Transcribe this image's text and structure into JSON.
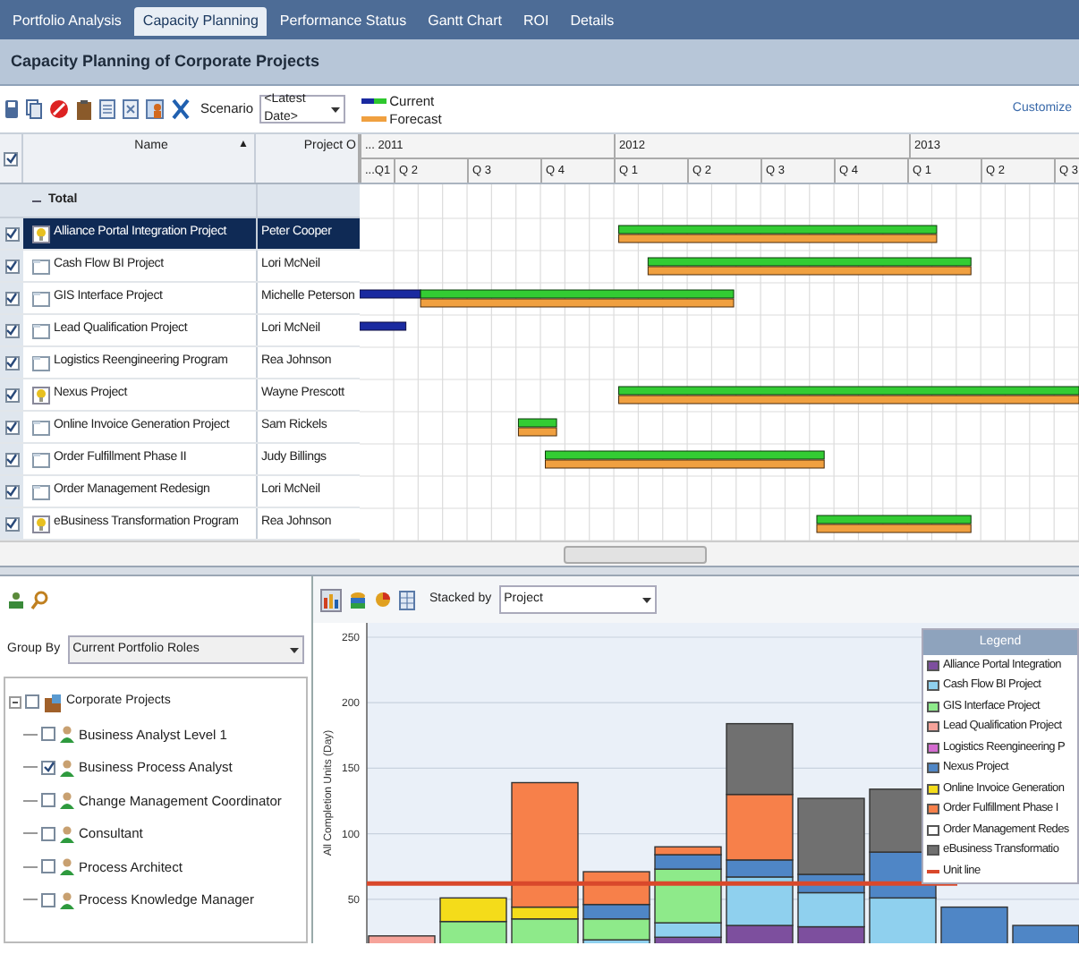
{
  "tabs": [
    {
      "label": "Portfolio Analysis",
      "selected": false
    },
    {
      "label": "Capacity Planning",
      "selected": true
    },
    {
      "label": "Performance Status",
      "selected": false
    },
    {
      "label": "Gantt Chart",
      "selected": false
    },
    {
      "label": "ROI",
      "selected": false
    },
    {
      "label": "Details",
      "selected": false
    }
  ],
  "title": "Capacity Planning of Corporate Projects",
  "toolbar": {
    "scenario_label": "Scenario",
    "scenario_value": "<Latest Date>",
    "customize": "Customize",
    "legend": [
      {
        "label": "Current",
        "kind": "current"
      },
      {
        "label": "Forecast",
        "kind": "forecast"
      }
    ]
  },
  "grid": {
    "header_checked": true,
    "columns": [
      "Name",
      "Project O"
    ],
    "sort_mark": "▲",
    "years": [
      "... 2011",
      "2012",
      "2013"
    ],
    "quarters": [
      "...Q1",
      "Q 2",
      "Q 3",
      "Q 4",
      "Q 1",
      "Q 2",
      "Q 3",
      "Q 4",
      "Q 1",
      "Q 2",
      "Q 3"
    ],
    "total": "Total",
    "rows": [
      {
        "name": "Alliance Portal Integration Project",
        "owner": "Peter Cooper",
        "kind": "idea",
        "checked": true,
        "selected": true
      },
      {
        "name": "Cash Flow BI Project",
        "owner": "Lori McNeil",
        "kind": "folder",
        "checked": true,
        "selected": false
      },
      {
        "name": "GIS Interface Project",
        "owner": "Michelle Peterson",
        "kind": "folder",
        "checked": true,
        "selected": false
      },
      {
        "name": "Lead Qualification Project",
        "owner": "Lori McNeil",
        "kind": "folder",
        "checked": true,
        "selected": false
      },
      {
        "name": "Logistics Reengineering Program",
        "owner": "Rea Johnson",
        "kind": "folder",
        "checked": true,
        "selected": false
      },
      {
        "name": "Nexus Project",
        "owner": "Wayne Prescott",
        "kind": "idea",
        "checked": true,
        "selected": false
      },
      {
        "name": "Online Invoice Generation Project",
        "owner": "Sam Rickels",
        "kind": "folder",
        "checked": true,
        "selected": false
      },
      {
        "name": "Order Fulfillment Phase II",
        "owner": "Judy Billings",
        "kind": "folder",
        "checked": true,
        "selected": false
      },
      {
        "name": "Order Management Redesign",
        "owner": "Lori McNeil",
        "kind": "folder",
        "checked": true,
        "selected": false
      },
      {
        "name": "eBusiness Transformation Program",
        "owner": "Rea Johnson",
        "kind": "idea",
        "checked": true,
        "selected": false
      }
    ]
  },
  "roles": {
    "group_by_label": "Group By",
    "group_by_value": "Current Portfolio Roles",
    "tree": [
      {
        "label": "Corporate Projects",
        "checked": false,
        "expanded": true,
        "children": [
          {
            "label": "Business Analyst Level 1",
            "checked": false
          },
          {
            "label": "Business Process Analyst",
            "checked": true
          },
          {
            "label": "Change Management Coordinator",
            "checked": false
          },
          {
            "label": "Consultant",
            "checked": false
          },
          {
            "label": "Process Architect",
            "checked": false
          },
          {
            "label": "Process Knowledge Manager",
            "checked": false
          }
        ]
      }
    ]
  },
  "chart_panel": {
    "stacked_by_label": "Stacked by",
    "stacked_by_value": "Project",
    "chart_data": {
      "type": "bar",
      "stacked": true,
      "grid": true,
      "legend": {
        "title": "Legend"
      },
      "ylabel": "All Completion Units (Day)",
      "ylim": [
        0,
        250
      ],
      "yticks": [
        50,
        100,
        150,
        200,
        250
      ],
      "series": [
        {
          "name": "Alliance Portal Integration",
          "color": "#7d4f9e",
          "values": [
            null,
            null,
            null,
            null,
            21,
            30,
            29,
            null,
            null,
            null
          ]
        },
        {
          "name": "Cash Flow BI Project",
          "color": "#8fd0ee",
          "values": [
            null,
            null,
            null,
            19,
            11,
            37,
            26,
            51,
            null,
            null
          ]
        },
        {
          "name": "GIS Interface Project",
          "color": "#8eea8a",
          "values": [
            null,
            33,
            35,
            16,
            41,
            null,
            null,
            null,
            null,
            null
          ]
        },
        {
          "name": "Lead Qualification Project",
          "color": "#f6a39a",
          "values": [
            22,
            null,
            null,
            null,
            null,
            null,
            null,
            null,
            null,
            null
          ]
        },
        {
          "name": "Logistics Reengineering P",
          "color": "#d46bd0",
          "values": [
            null,
            null,
            null,
            null,
            null,
            null,
            null,
            null,
            null,
            null
          ]
        },
        {
          "name": "Nexus Project",
          "color": "#4f86c6",
          "values": [
            null,
            null,
            null,
            11,
            11,
            13,
            14,
            35,
            44,
            30
          ]
        },
        {
          "name": "Online Invoice Generation",
          "color": "#f4dc1a",
          "values": [
            null,
            18,
            9,
            null,
            null,
            null,
            null,
            null,
            null,
            null
          ]
        },
        {
          "name": "Order Fulfillment Phase I",
          "color": "#f7804a",
          "values": [
            null,
            null,
            95,
            25,
            6,
            50,
            null,
            null,
            null,
            null
          ]
        },
        {
          "name": "Order Management Redes",
          "color": "#ffffff",
          "values": [
            null,
            null,
            null,
            null,
            null,
            null,
            null,
            null,
            null,
            null
          ]
        },
        {
          "name": "eBusiness Transformatio",
          "color": "#707070",
          "values": [
            null,
            null,
            null,
            null,
            null,
            54,
            58,
            48,
            null,
            null
          ]
        }
      ],
      "ref_lines": [
        {
          "axis": "y",
          "value": 62,
          "label": "Unit line",
          "color": "#d9482b"
        }
      ]
    }
  }
}
